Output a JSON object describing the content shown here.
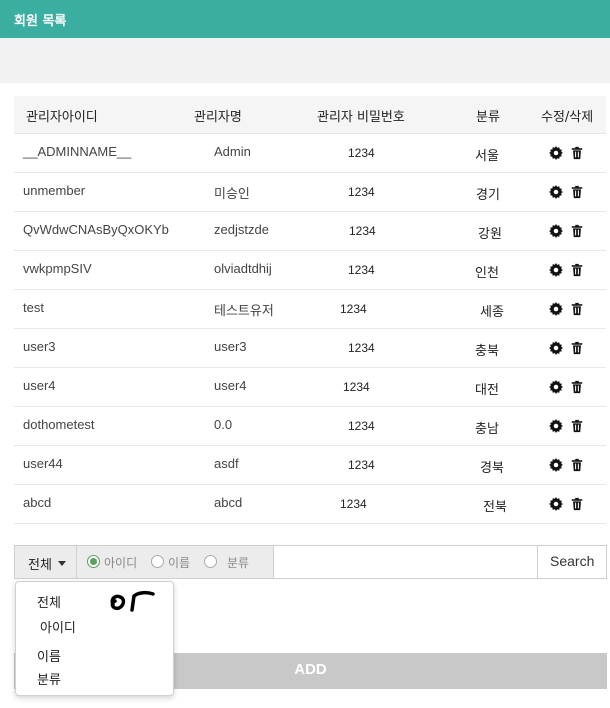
{
  "header": {
    "title": "회원 목록"
  },
  "table": {
    "columns": [
      "관리자아이디",
      "관리자명",
      "관리자 비밀번호",
      "분류",
      "수정/삭제"
    ],
    "rows": [
      {
        "id": "__ADMINNAME__",
        "name": "Admin",
        "password": "1234",
        "category": "서울"
      },
      {
        "id": "unmember",
        "name": "미승인",
        "password": "1234",
        "category": "경기"
      },
      {
        "id": "QvWdwCNAsByQxOKYb",
        "name": "zedjstzde",
        "password": "1234",
        "category": "강원"
      },
      {
        "id": "vwkpmpSIV",
        "name": "olviadtdhij",
        "password": "1234",
        "category": "인천"
      },
      {
        "id": "test",
        "name": "테스트유저",
        "password": "1234",
        "category": "세종"
      },
      {
        "id": "user3",
        "name": "user3",
        "password": "1234",
        "category": "충북"
      },
      {
        "id": "user4",
        "name": "user4",
        "password": "1234",
        "category": "대전"
      },
      {
        "id": "dothometest",
        "name": "0.0",
        "password": "1234",
        "category": "충남"
      },
      {
        "id": "user44",
        "name": "asdf",
        "password": "1234",
        "category": "경북"
      },
      {
        "id": "abcd",
        "name": "abcd",
        "password": "1234",
        "category": "전북"
      }
    ],
    "edit_icon": "gear-icon",
    "delete_icon": "trash-icon"
  },
  "search": {
    "dropdown_label": "전체",
    "radios": [
      {
        "label": "아이디",
        "selected": true
      },
      {
        "label": "이름",
        "selected": false
      },
      {
        "label": "분류",
        "selected": false
      }
    ],
    "input_value": "",
    "button_label": "Search",
    "radio_selected_color": "#5aa05a"
  },
  "dropdown_menu": {
    "items": [
      "전체",
      "아이디",
      "이름",
      "분류"
    ],
    "annotation": "or"
  },
  "add_button": {
    "label": "ADD"
  },
  "colors": {
    "header": "#3aaea0",
    "add_button": "#c8c8c8"
  }
}
